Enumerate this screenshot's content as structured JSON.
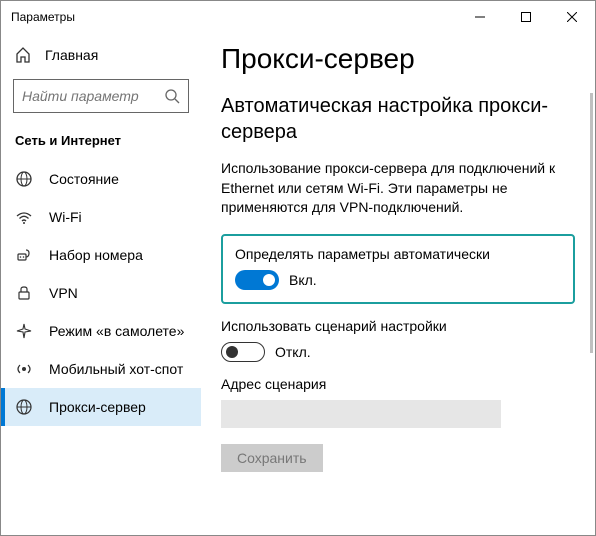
{
  "window": {
    "title": "Параметры"
  },
  "sidebar": {
    "home": "Главная",
    "search_placeholder": "Найти параметр",
    "section": "Сеть и Интернет",
    "items": [
      {
        "label": "Состояние"
      },
      {
        "label": "Wi-Fi"
      },
      {
        "label": "Набор номера"
      },
      {
        "label": "VPN"
      },
      {
        "label": "Режим «в самолете»"
      },
      {
        "label": "Мобильный хот-спот"
      },
      {
        "label": "Прокси-сервер"
      }
    ]
  },
  "main": {
    "heading": "Прокси-сервер",
    "subheading": "Автоматическая настройка прокси-сервера",
    "description": "Использование прокси-сервера для подключений к Ethernet или сетям Wi-Fi. Эти параметры не применяются для VPN-подключений.",
    "auto_detect": {
      "label": "Определять параметры автоматически",
      "state": "Вкл."
    },
    "use_script": {
      "label": "Использовать сценарий настройки",
      "state": "Откл."
    },
    "script_addr_label": "Адрес сценария",
    "script_addr_value": "",
    "save": "Сохранить"
  }
}
